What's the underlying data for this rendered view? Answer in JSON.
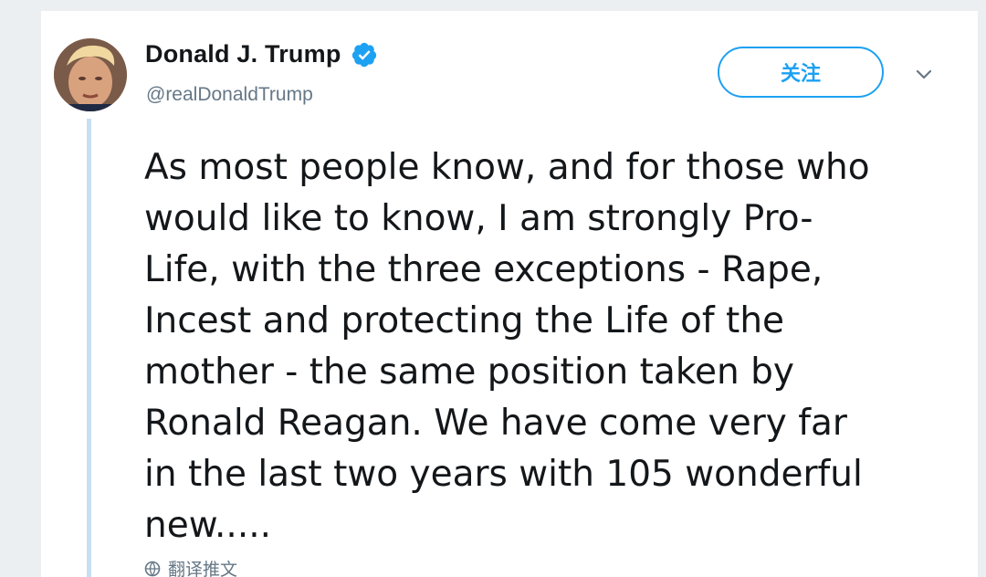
{
  "profile": {
    "name": "Donald J. Trump",
    "handle": "@realDonaldTrump",
    "verified": true
  },
  "actions": {
    "follow_label": "关注"
  },
  "tweet": {
    "lines": [
      "As most people know, and for those who",
      "would like to know, I am strongly Pro-",
      "Life, with the three exceptions - Rape,",
      "Incest and protecting the Life of the",
      "mother - the same position taken by",
      "Ronald Reagan. We have come very far",
      "in the last two years with 105 wonderful",
      "new....."
    ],
    "translate_label": "翻译推文"
  },
  "colors": {
    "accent": "#1da1f2",
    "secondary_text": "#657786",
    "thread_line": "#c7dff3",
    "background": "#eceff1"
  },
  "icons": {
    "verified": "verified-badge-icon",
    "menu": "chevron-down-icon",
    "translate": "globe-icon"
  }
}
